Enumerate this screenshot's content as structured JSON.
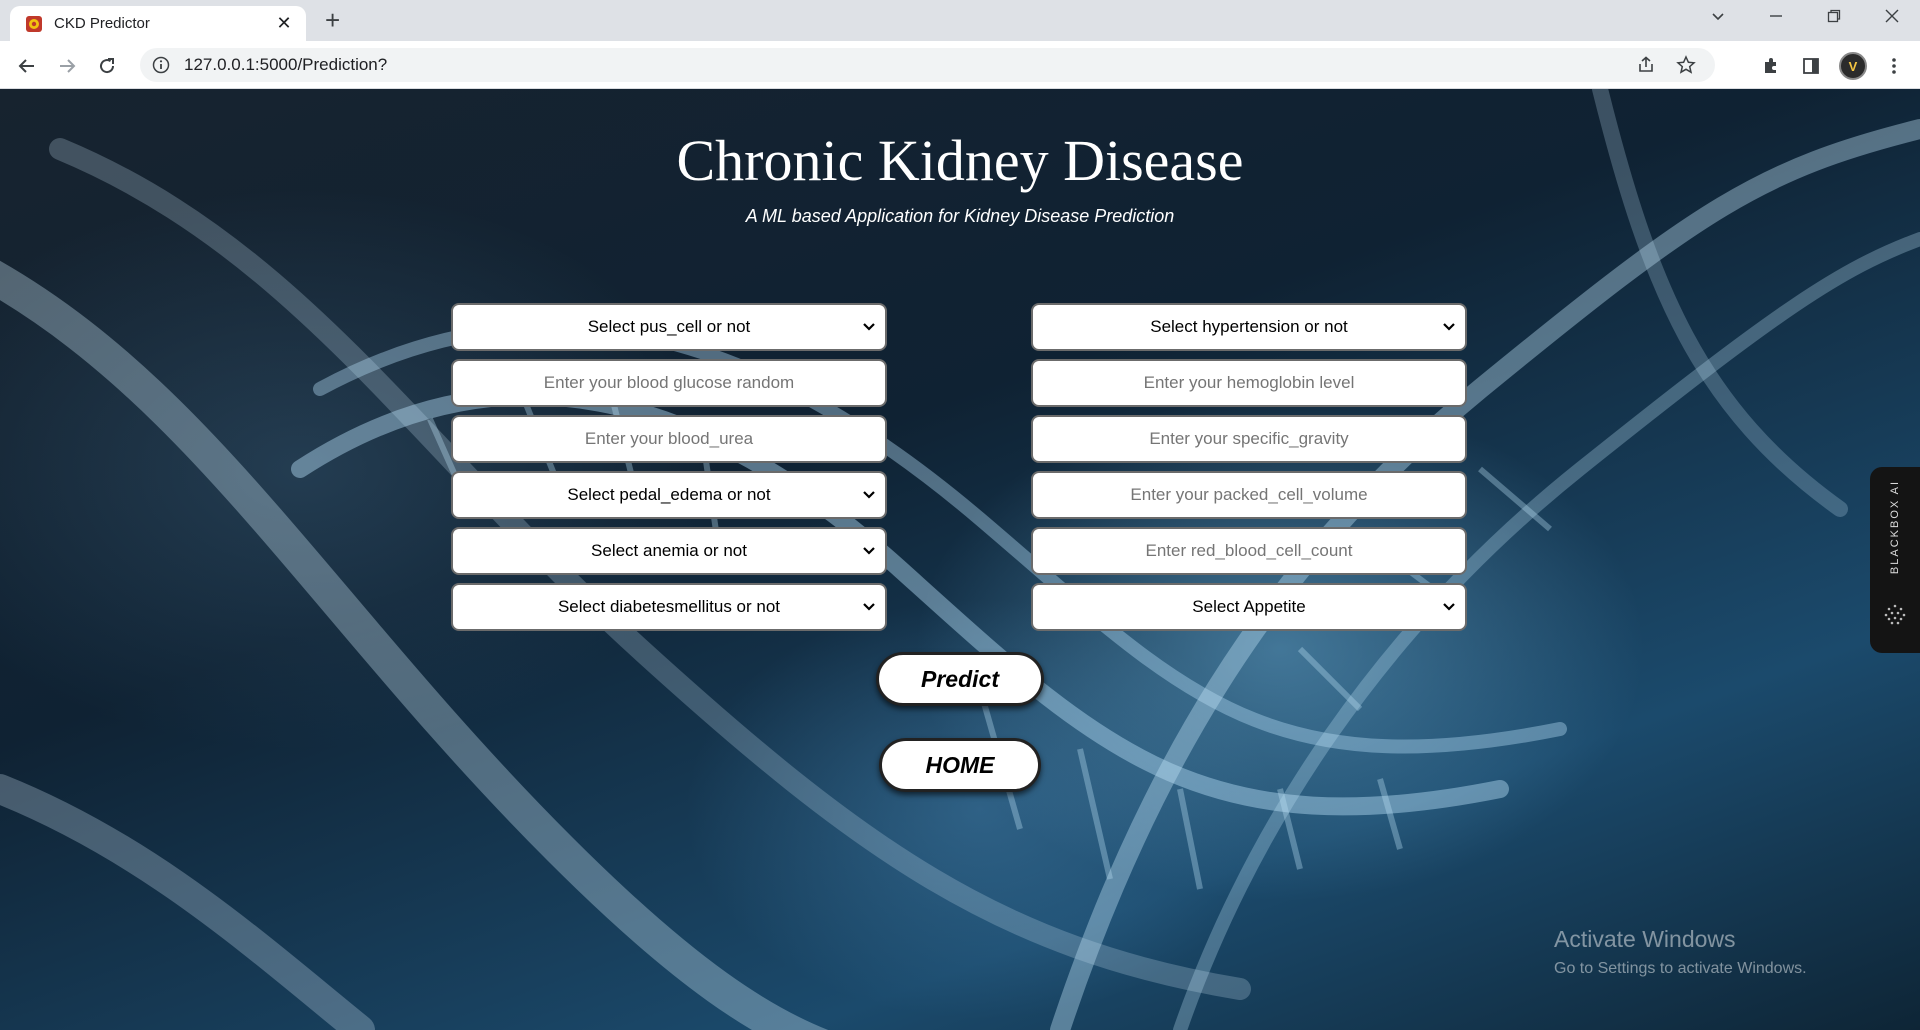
{
  "browser": {
    "tab_title": "CKD Predictor",
    "tab_close": "✕",
    "new_tab": "+",
    "url": "127.0.0.1:5000/Prediction?",
    "avatar_initials": "V"
  },
  "page": {
    "title": "Chronic Kidney Disease",
    "subtitle": "A ML based Application for Kidney Disease Prediction",
    "left_fields": [
      {
        "type": "select",
        "text": "Select pus_cell or not"
      },
      {
        "type": "input",
        "text": "Enter your blood glucose random"
      },
      {
        "type": "input",
        "text": "Enter your blood_urea"
      },
      {
        "type": "select",
        "text": "Select pedal_edema or not"
      },
      {
        "type": "select",
        "text": "Select anemia or not"
      },
      {
        "type": "select",
        "text": "Select diabetesmellitus or not"
      }
    ],
    "right_fields": [
      {
        "type": "select",
        "text": "Select hypertension or not"
      },
      {
        "type": "input",
        "text": "Enter your hemoglobin level"
      },
      {
        "type": "input",
        "text": "Enter your specific_gravity"
      },
      {
        "type": "input",
        "text": "Enter your packed_cell_volume"
      },
      {
        "type": "input",
        "text": "Enter red_blood_cell_count"
      },
      {
        "type": "select",
        "text": "Select Appetite"
      }
    ],
    "predict_label": "Predict",
    "home_label": "HOME"
  },
  "extension": {
    "label": "BLACKBOX AI"
  },
  "watermark": {
    "line1": "Activate Windows",
    "line2": "Go to Settings to activate Windows."
  },
  "colors": {
    "page_text": "#ffffff",
    "field_border": "#6b6b6b",
    "button_bg": "#ffffff"
  }
}
